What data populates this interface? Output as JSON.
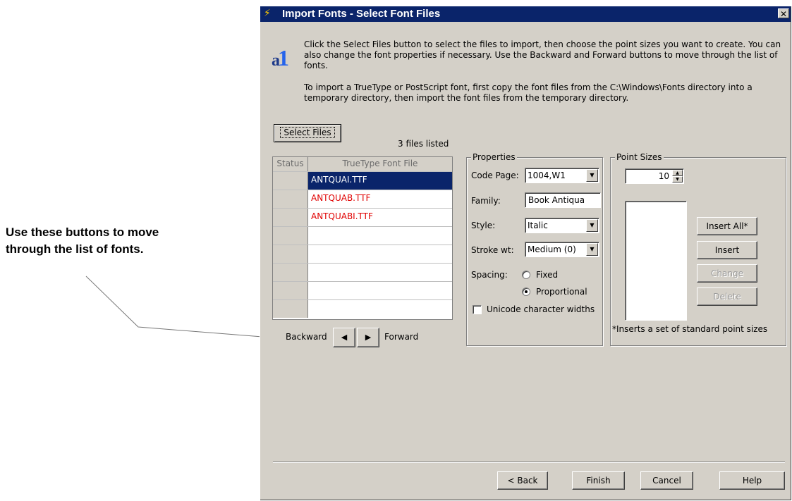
{
  "annotation": {
    "line1": "Use these buttons to move",
    "line2": "through the list of fonts."
  },
  "window": {
    "title": "Import Fonts - Select Font Files",
    "close_glyph": "✕",
    "app_icon": "wand-icon"
  },
  "intro": {
    "paragraph1": "Click the Select Files button to select the files to import, then choose the point sizes you want to create. You can also change the font properties if necessary. Use the Backward and Forward buttons to move through the list of fonts.",
    "paragraph2": "To import a TrueType or PostScript font, first copy the font files from the C:\\Windows\\Fonts directory into a temporary directory, then import the font files from the temporary directory."
  },
  "files": {
    "select_button": "Select Files",
    "count_text": "3 files listed",
    "columns": {
      "status": "Status",
      "file": "TrueType Font File"
    },
    "rows": [
      {
        "status": "",
        "file": "ANTQUAI.TTF",
        "selected": true
      },
      {
        "status": "",
        "file": "ANTQUAB.TTF",
        "selected": false
      },
      {
        "status": "",
        "file": "ANTQUABI.TTF",
        "selected": false
      },
      {
        "status": "",
        "file": "",
        "selected": false
      },
      {
        "status": "",
        "file": "",
        "selected": false
      },
      {
        "status": "",
        "file": "",
        "selected": false
      },
      {
        "status": "",
        "file": "",
        "selected": false
      },
      {
        "status": "",
        "file": "",
        "selected": false
      }
    ],
    "selected_color": "#0a246a",
    "unselected_file_color": "#e00000"
  },
  "nav": {
    "backward_label": "Backward",
    "forward_label": "Forward",
    "backward_glyph": "◀",
    "forward_glyph": "▶"
  },
  "properties": {
    "legend": "Properties",
    "code_page_label": "Code Page:",
    "code_page_value": "1004,W1",
    "family_label": "Family:",
    "family_value": "Book Antiqua",
    "style_label": "Style:",
    "style_value": "Italic",
    "stroke_label": "Stroke wt:",
    "stroke_value": "Medium (0)",
    "spacing_label": "Spacing:",
    "spacing_fixed": "Fixed",
    "spacing_proportional": "Proportional",
    "spacing_selected": "Proportional",
    "unicode_label": "Unicode character widths",
    "unicode_checked": false
  },
  "point_sizes": {
    "legend": "Point Sizes",
    "spin_value": "10",
    "insert_all": "Insert All*",
    "insert": "Insert",
    "change": "Change",
    "delete": "Delete",
    "footnote": "*Inserts a set of standard point sizes"
  },
  "footer": {
    "back": "< Back",
    "finish": "Finish",
    "cancel": "Cancel",
    "help": "Help"
  },
  "colors": {
    "window_bg": "#d4d0c8",
    "titlebar": "#0a246a"
  }
}
